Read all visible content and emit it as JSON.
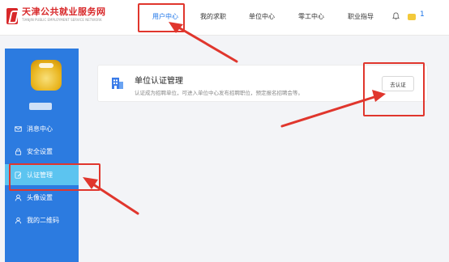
{
  "header": {
    "logo_title": "天津公共就业服务网",
    "logo_sub": "TIANJIN PUBLIC EMPLOYMENT SERVICE NETWORK",
    "nav": [
      {
        "label": "用户中心",
        "active": true
      },
      {
        "label": "我的求职",
        "active": false
      },
      {
        "label": "单位中心",
        "active": false
      },
      {
        "label": "零工中心",
        "active": false
      },
      {
        "label": "职业指导",
        "active": false
      }
    ],
    "username_fragment": "1"
  },
  "sidebar": {
    "items": [
      {
        "label": "消息中心",
        "icon": "mail-icon"
      },
      {
        "label": "安全设置",
        "icon": "lock-icon"
      },
      {
        "label": "认证管理",
        "icon": "edit-document-icon",
        "active": true
      },
      {
        "label": "头像设置",
        "icon": "user-icon"
      },
      {
        "label": "我的二维码",
        "icon": "user-circle-icon"
      }
    ]
  },
  "main": {
    "card": {
      "title": "单位认证管理",
      "description": "认证成为招聘单位，可进入单位中心发布招聘职位，预定报名招聘会等。",
      "button_label": "去认证",
      "icon": "building-icon"
    }
  },
  "colors": {
    "accent": "#1a73e8",
    "sidebar": "#2c7be0",
    "sidebar_active": "#5cc4f0",
    "annotation": "#e0362d",
    "logo": "#d8282a"
  }
}
